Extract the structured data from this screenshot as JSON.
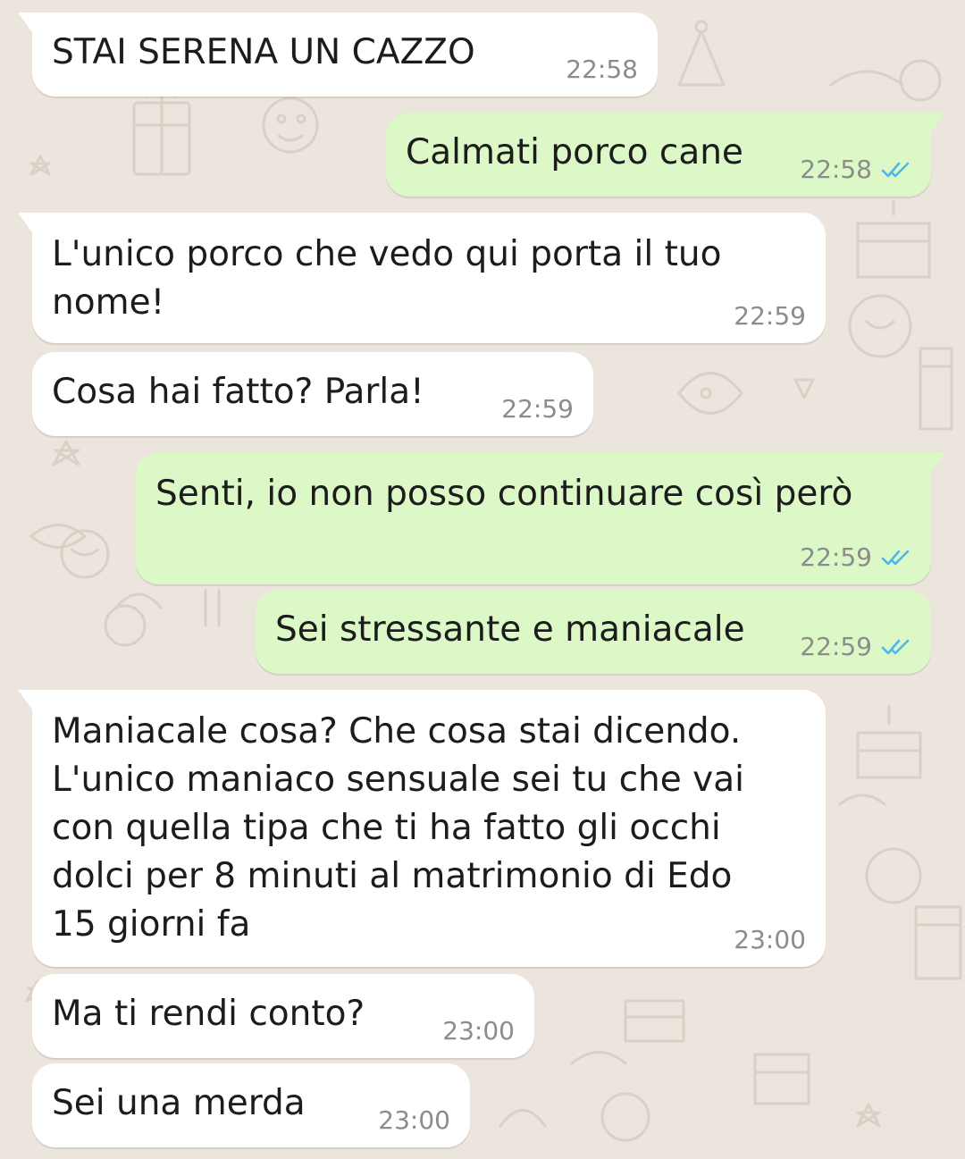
{
  "chat": {
    "messages": [
      {
        "direction": "incoming",
        "lines": [
          "STAI SERENA UN CAZZO"
        ],
        "time": "22:58"
      },
      {
        "direction": "outgoing",
        "lines": [
          "Calmati porco cane"
        ],
        "time": "22:58",
        "status": "read"
      },
      {
        "direction": "incoming",
        "lines": [
          "L'unico porco che vedo qui porta il tuo",
          "nome!"
        ],
        "time": "22:59"
      },
      {
        "direction": "incoming",
        "lines": [
          "Cosa hai fatto? Parla!"
        ],
        "time": "22:59"
      },
      {
        "direction": "outgoing",
        "lines": [
          "Senti, io non posso continuare così però"
        ],
        "time": "22:59",
        "status": "read"
      },
      {
        "direction": "outgoing",
        "lines": [
          "Sei stressante e maniacale"
        ],
        "time": "22:59",
        "status": "read"
      },
      {
        "direction": "incoming",
        "lines": [
          "Maniacale cosa? Che cosa stai dicendo.",
          "L'unico maniaco sensuale sei tu che vai",
          "con quella tipa che ti ha fatto gli occhi",
          "dolci per 8 minuti al matrimonio di Edo",
          "15 giorni fa"
        ],
        "time": "23:00"
      },
      {
        "direction": "incoming",
        "lines": [
          "Ma ti rendi conto?"
        ],
        "time": "23:00"
      },
      {
        "direction": "incoming",
        "lines": [
          "Sei una merda"
        ],
        "time": "23:00"
      }
    ]
  },
  "colors": {
    "wallpaper": "#ECE5DD",
    "incoming_bubble": "#FFFFFF",
    "outgoing_bubble": "#DCF8C6",
    "read_ticks": "#4FB6EC",
    "timestamp": "#8C8C8C"
  },
  "icons": {
    "read_receipt": "double-check-icon"
  }
}
